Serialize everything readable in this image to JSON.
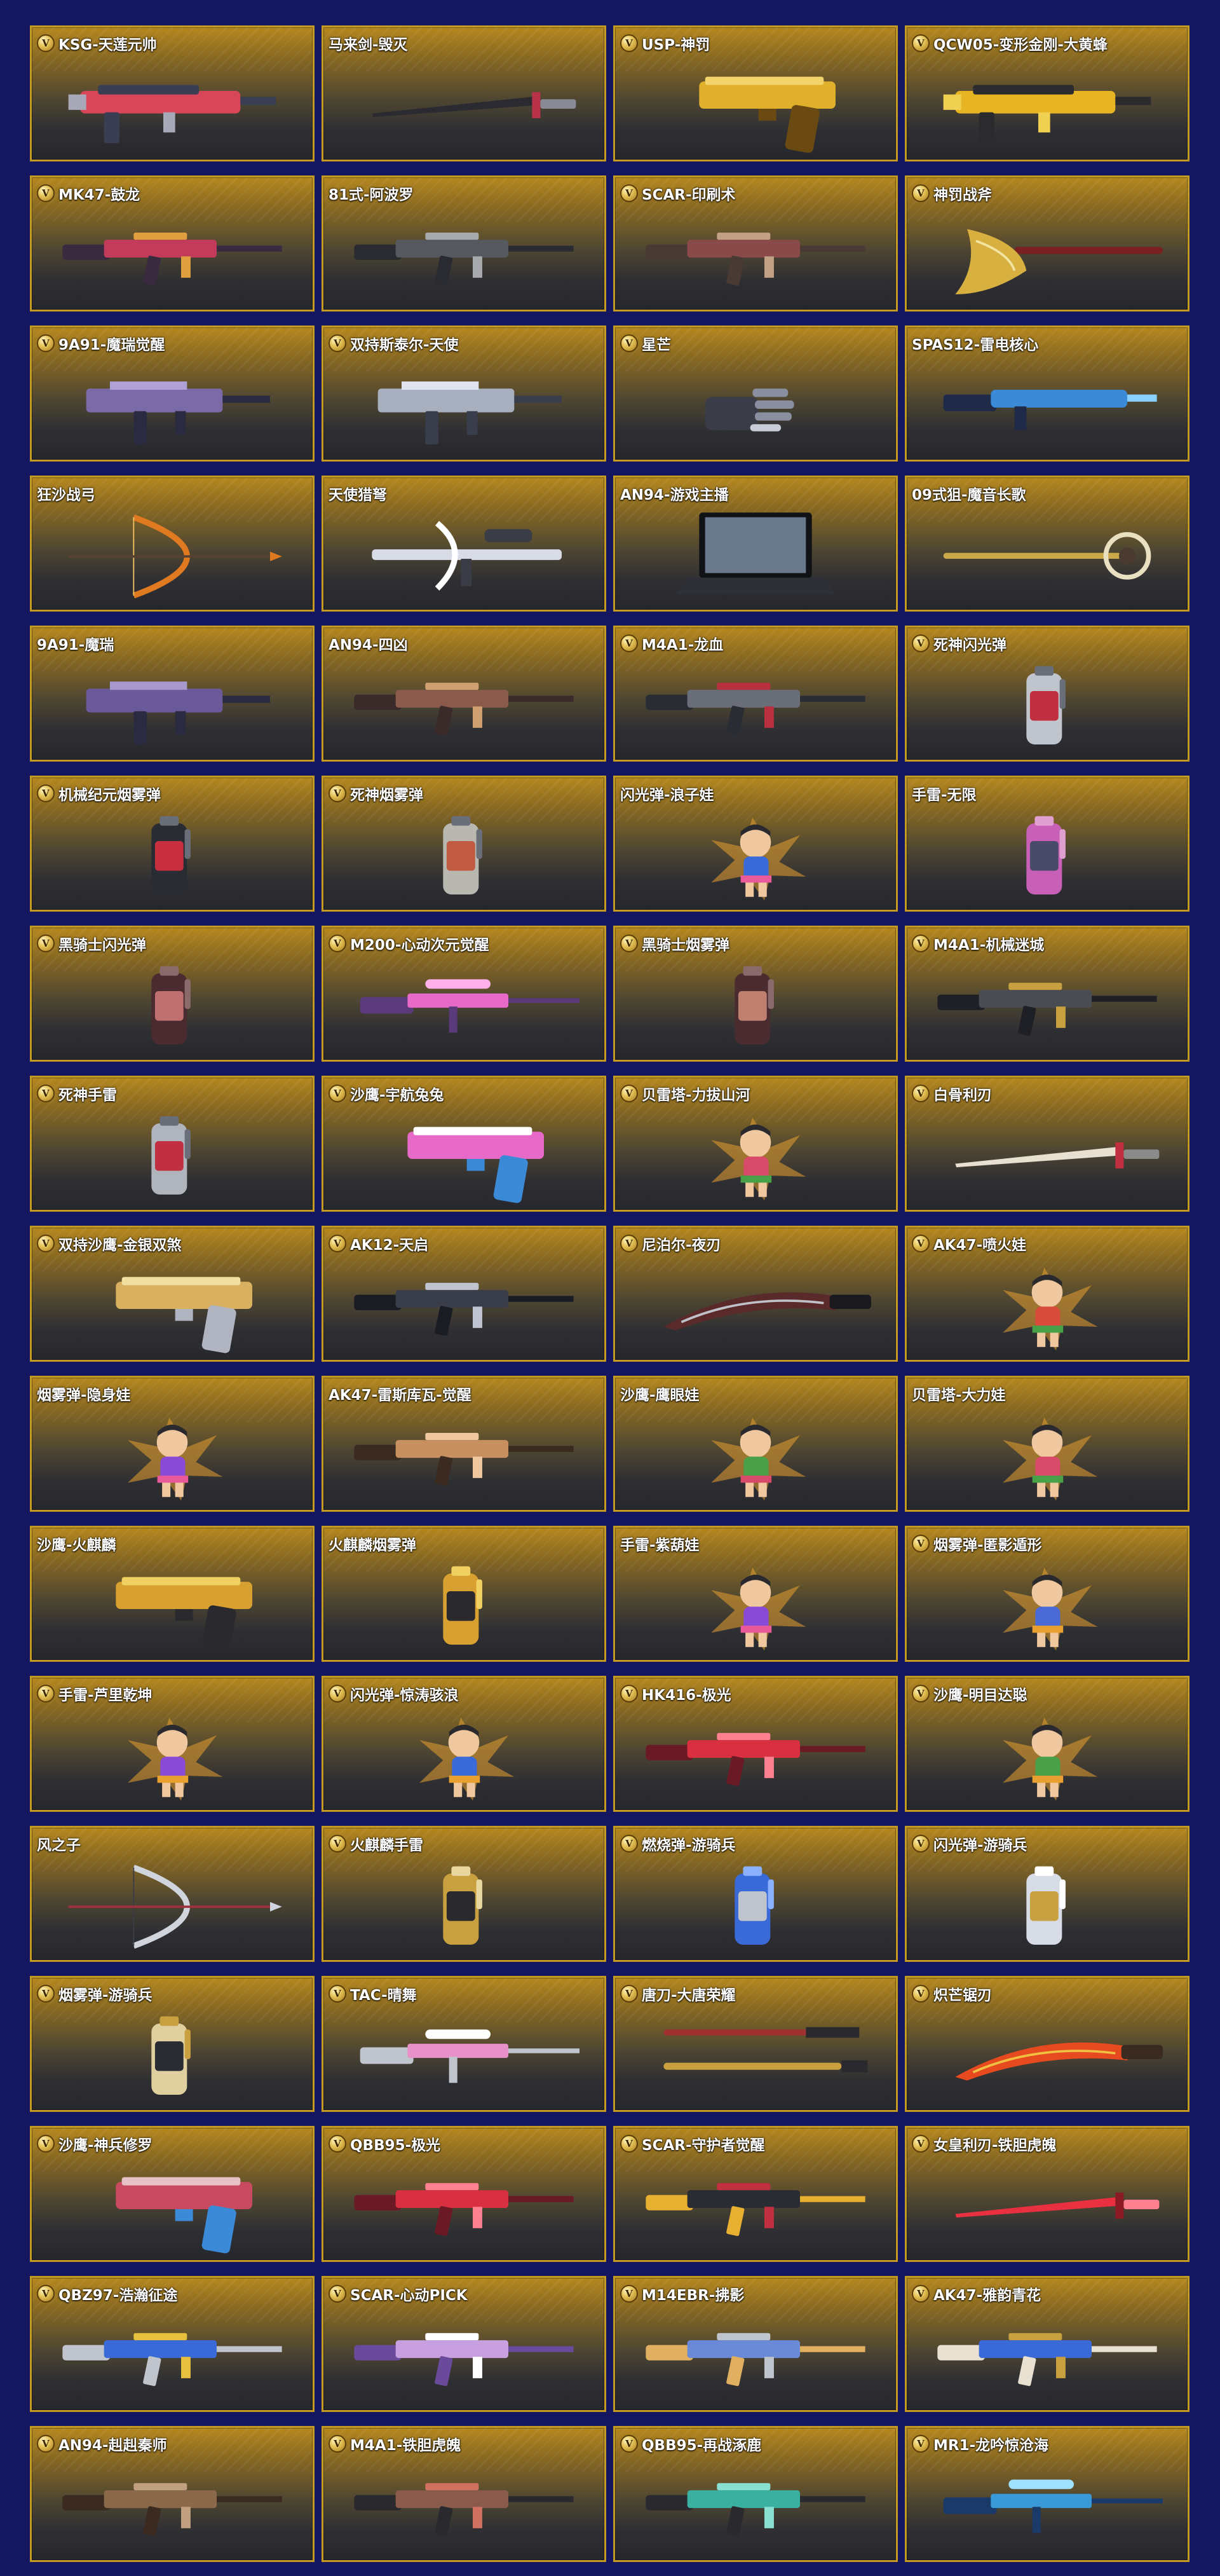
{
  "colors": {
    "background": "#151660",
    "card_border": "#c39a22",
    "card_top": "#b5871f",
    "card_bottom": "#26272c"
  },
  "items": [
    {
      "name": "KSG-天莲元帅",
      "badge": "V",
      "kind": "gun",
      "palette": [
        "#d8465a",
        "#3a3e52",
        "#a7a9b8"
      ]
    },
    {
      "name": "马来剑-毁灭",
      "badge": "",
      "kind": "sword",
      "palette": [
        "#2a2a30",
        "#b8324a",
        "#8a8a96"
      ]
    },
    {
      "name": "USP-神罚",
      "badge": "V",
      "kind": "pistol",
      "palette": [
        "#e0b02c",
        "#6a4a12",
        "#f2d46a"
      ]
    },
    {
      "name": "QCW05-变形金刚-大黄蜂",
      "badge": "V",
      "kind": "gun",
      "palette": [
        "#e7b423",
        "#2b2b2e",
        "#f0d050"
      ]
    },
    {
      "name": "MK47-鼓龙",
      "badge": "V",
      "kind": "rifle",
      "palette": [
        "#c23b5a",
        "#3a2a40",
        "#e0a040"
      ]
    },
    {
      "name": "81式-阿波罗",
      "badge": "",
      "kind": "rifle",
      "palette": [
        "#55585e",
        "#2a2b30",
        "#a8a9ad"
      ]
    },
    {
      "name": "SCAR-印刷术",
      "badge": "V",
      "kind": "rifle",
      "palette": [
        "#8a4a4a",
        "#4a3a34",
        "#c2a085"
      ]
    },
    {
      "name": "神罚战斧",
      "badge": "V",
      "kind": "axe",
      "palette": [
        "#d8b040",
        "#7a2020",
        "#f2e4a0"
      ]
    },
    {
      "name": "9A91-魔瑞觉醒",
      "badge": "V",
      "kind": "smg",
      "palette": [
        "#7a6aa8",
        "#2a2a40",
        "#b0a0d8"
      ]
    },
    {
      "name": "双持斯泰尔-天使",
      "badge": "V",
      "kind": "smg",
      "palette": [
        "#a8b0c0",
        "#3a3e4c",
        "#dfe4ee"
      ]
    },
    {
      "name": "星芒",
      "badge": "V",
      "kind": "glove",
      "palette": [
        "#8a8fa0",
        "#3a3d48",
        "#c8ccd6"
      ]
    },
    {
      "name": "SPAS12-雷电核心",
      "badge": "",
      "kind": "shotgun",
      "palette": [
        "#3a8ad8",
        "#1e2a48",
        "#8ad0ff"
      ]
    },
    {
      "name": "狂沙战弓",
      "badge": "",
      "kind": "bow",
      "palette": [
        "#e07a20",
        "#5a4030",
        "#f2c060"
      ]
    },
    {
      "name": "天使猎弩",
      "badge": "",
      "kind": "crossbow",
      "palette": [
        "#d8dce6",
        "#3a3c46",
        "#ffffff"
      ]
    },
    {
      "name": "AN94-游戏主播",
      "badge": "",
      "kind": "laptop",
      "palette": [
        "#2e3038",
        "#111216",
        "#6a7a8c"
      ]
    },
    {
      "name": "09式狙-魔音长歌",
      "badge": "",
      "kind": "staff",
      "palette": [
        "#c9a94a",
        "#4a3a30",
        "#e8e0c0"
      ]
    },
    {
      "name": "9A91-魔瑞",
      "badge": "",
      "kind": "smg",
      "palette": [
        "#6a5a9a",
        "#2a2a40",
        "#a898d0"
      ]
    },
    {
      "name": "AN94-四凶",
      "badge": "",
      "kind": "rifle",
      "palette": [
        "#8a5a4a",
        "#3a2a2a",
        "#d0a070"
      ]
    },
    {
      "name": "M4A1-龙血",
      "badge": "V",
      "kind": "rifle",
      "palette": [
        "#6a6e78",
        "#2a2c34",
        "#b83040"
      ]
    },
    {
      "name": "死神闪光弹",
      "badge": "V",
      "kind": "canister",
      "palette": [
        "#c0c4cc",
        "#c03040",
        "#6a6e78"
      ]
    },
    {
      "name": "机械纪元烟雾弹",
      "badge": "V",
      "kind": "canister",
      "palette": [
        "#2a2c34",
        "#c83040",
        "#6a6e78"
      ]
    },
    {
      "name": "死神烟雾弹",
      "badge": "V",
      "kind": "canister",
      "palette": [
        "#b8b8b0",
        "#c05a40",
        "#6a6e78"
      ]
    },
    {
      "name": "闪光弹-浪子娃",
      "badge": "",
      "kind": "doll",
      "palette": [
        "#3a6ad8",
        "#e85a9a",
        "#f0c8a0"
      ]
    },
    {
      "name": "手雷-无限",
      "badge": "",
      "kind": "canister",
      "palette": [
        "#c860b8",
        "#4a4a6a",
        "#e0a0d0"
      ]
    },
    {
      "name": "黑骑士闪光弹",
      "badge": "V",
      "kind": "canister",
      "palette": [
        "#4a2c30",
        "#c07070",
        "#8a6a6a"
      ]
    },
    {
      "name": "M200-心动次元觉醒",
      "badge": "V",
      "kind": "sniper",
      "palette": [
        "#e86ac8",
        "#5a3a7a",
        "#ffb0e8"
      ]
    },
    {
      "name": "黑骑士烟雾弹",
      "badge": "V",
      "kind": "canister",
      "palette": [
        "#4a2c30",
        "#c08070",
        "#8a6a6a"
      ]
    },
    {
      "name": "M4A1-机械迷城",
      "badge": "V",
      "kind": "rifle",
      "palette": [
        "#4a4c54",
        "#1e2026",
        "#c8a040"
      ]
    },
    {
      "name": "死神手雷",
      "badge": "V",
      "kind": "canister",
      "palette": [
        "#b0b4bc",
        "#c03040",
        "#6a6e78"
      ]
    },
    {
      "name": "沙鹰-宇航兔兔",
      "badge": "V",
      "kind": "pistol",
      "palette": [
        "#e86ac8",
        "#3a8ad8",
        "#ffffff"
      ]
    },
    {
      "name": "贝雷塔-力拔山河",
      "badge": "V",
      "kind": "doll",
      "palette": [
        "#d84a6a",
        "#48a048",
        "#f0c8a0"
      ]
    },
    {
      "name": "白骨利刃",
      "badge": "V",
      "kind": "sword",
      "palette": [
        "#e8e0d0",
        "#c03040",
        "#8a8a8a"
      ]
    },
    {
      "name": "双持沙鹰-金银双煞",
      "badge": "V",
      "kind": "pistol",
      "palette": [
        "#d8b060",
        "#b0b4c0",
        "#f0e0a0"
      ]
    },
    {
      "name": "AK12-天启",
      "badge": "V",
      "kind": "rifle",
      "palette": [
        "#3a3e4a",
        "#1a1c24",
        "#c0c4d0"
      ]
    },
    {
      "name": "尼泊尔-夜刃",
      "badge": "V",
      "kind": "blade",
      "palette": [
        "#5a2a2a",
        "#1a1a1e",
        "#c0c0c8"
      ]
    },
    {
      "name": "AK47-喷火娃",
      "badge": "V",
      "kind": "doll",
      "palette": [
        "#d84a3a",
        "#48a048",
        "#f0c8a0"
      ]
    },
    {
      "name": "烟雾弹-隐身娃",
      "badge": "",
      "kind": "doll",
      "palette": [
        "#8a4ad8",
        "#e85a9a",
        "#f0c8a0"
      ]
    },
    {
      "name": "AK47-雷斯库瓦-觉醒",
      "badge": "",
      "kind": "rifle",
      "palette": [
        "#c89060",
        "#3a2a20",
        "#f0c8a0"
      ]
    },
    {
      "name": "沙鹰-鹰眼娃",
      "badge": "",
      "kind": "doll",
      "palette": [
        "#4aa048",
        "#d84a6a",
        "#f0c8a0"
      ]
    },
    {
      "name": "贝雷塔-大力娃",
      "badge": "",
      "kind": "doll",
      "palette": [
        "#d84a6a",
        "#48a048",
        "#f0c8a0"
      ]
    },
    {
      "name": "沙鹰-火麒麟",
      "badge": "",
      "kind": "pistol",
      "palette": [
        "#d8a030",
        "#2a2a2e",
        "#f0d060"
      ]
    },
    {
      "name": "火麒麟烟雾弹",
      "badge": "",
      "kind": "canister",
      "palette": [
        "#d8a030",
        "#2a2a2e",
        "#f0d060"
      ]
    },
    {
      "name": "手雷-紫葫娃",
      "badge": "",
      "kind": "doll",
      "palette": [
        "#8a4ad8",
        "#e85a9a",
        "#f0c8a0"
      ]
    },
    {
      "name": "烟雾弹-匿影遁形",
      "badge": "V",
      "kind": "doll",
      "palette": [
        "#4a6ad8",
        "#e8a030",
        "#f0c8a0"
      ]
    },
    {
      "name": "手雷-芦里乾坤",
      "badge": "V",
      "kind": "doll",
      "palette": [
        "#8a4ad8",
        "#e8a030",
        "#f0c8a0"
      ]
    },
    {
      "name": "闪光弹-惊涛骇浪",
      "badge": "V",
      "kind": "doll",
      "palette": [
        "#3a6ad8",
        "#e8a030",
        "#f0c8a0"
      ]
    },
    {
      "name": "HK416-极光",
      "badge": "V",
      "kind": "rifle",
      "palette": [
        "#d83040",
        "#6a1a24",
        "#ff8090"
      ]
    },
    {
      "name": "沙鹰-明目达聪",
      "badge": "V",
      "kind": "doll",
      "palette": [
        "#4aa048",
        "#e8a030",
        "#f0c8a0"
      ]
    },
    {
      "name": "风之子",
      "badge": "",
      "kind": "bow",
      "palette": [
        "#d0d4dc",
        "#a03040",
        "#3a3c46"
      ]
    },
    {
      "name": "火麒麟手雷",
      "badge": "V",
      "kind": "canister",
      "palette": [
        "#c8a040",
        "#2a2a2e",
        "#e8d8a0"
      ]
    },
    {
      "name": "燃烧弹-游骑兵",
      "badge": "V",
      "kind": "canister",
      "palette": [
        "#3a6ad8",
        "#c0c4cc",
        "#8ab0ff"
      ]
    },
    {
      "name": "闪光弹-游骑兵",
      "badge": "V",
      "kind": "canister",
      "palette": [
        "#d8dce6",
        "#c8a040",
        "#ffffff"
      ]
    },
    {
      "name": "烟雾弹-游骑兵",
      "badge": "V",
      "kind": "canister",
      "palette": [
        "#e0d0a0",
        "#2a2c34",
        "#c8a040"
      ]
    },
    {
      "name": "TAC-晴舞",
      "badge": "V",
      "kind": "sniper",
      "palette": [
        "#e890c8",
        "#c0c4cc",
        "#ffffff"
      ]
    },
    {
      "name": "唐刀-大唐荣耀",
      "badge": "V",
      "kind": "katana",
      "palette": [
        "#c8a040",
        "#2a2a2e",
        "#a03030"
      ]
    },
    {
      "name": "炽芒锯刃",
      "badge": "V",
      "kind": "blade",
      "palette": [
        "#e84a20",
        "#3a2a20",
        "#f0c040"
      ]
    },
    {
      "name": "沙鹰-神兵修罗",
      "badge": "V",
      "kind": "pistol",
      "palette": [
        "#c84a60",
        "#3a8ad8",
        "#e8c0c8"
      ]
    },
    {
      "name": "QBB95-极光",
      "badge": "V",
      "kind": "rifle",
      "palette": [
        "#d83040",
        "#6a1a24",
        "#ff8090"
      ]
    },
    {
      "name": "SCAR-守护者觉醒",
      "badge": "V",
      "kind": "rifle",
      "palette": [
        "#2a2c34",
        "#e8b030",
        "#c03040"
      ]
    },
    {
      "name": "女皇利刃-铁胆虎魄",
      "badge": "V",
      "kind": "sword",
      "palette": [
        "#e83040",
        "#8a1a24",
        "#ff8090"
      ]
    },
    {
      "name": "QBZ97-浩瀚征途",
      "badge": "V",
      "kind": "rifle",
      "palette": [
        "#3a6ad8",
        "#c0c4cc",
        "#e8c040"
      ]
    },
    {
      "name": "SCAR-心动PICK",
      "badge": "V",
      "kind": "rifle",
      "palette": [
        "#c8a0e0",
        "#6a4a9a",
        "#ffffff"
      ]
    },
    {
      "name": "M14EBR-拂影",
      "badge": "V",
      "kind": "rifle",
      "palette": [
        "#6a8ad8",
        "#e0b060",
        "#c0c4cc"
      ]
    },
    {
      "name": "AK47-雅韵青花",
      "badge": "V",
      "kind": "rifle",
      "palette": [
        "#3a6ad8",
        "#e8e0d0",
        "#c8a040"
      ]
    },
    {
      "name": "AN94-赳赳秦师",
      "badge": "V",
      "kind": "rifle",
      "palette": [
        "#8a6a4a",
        "#3a2a20",
        "#c0a080"
      ]
    },
    {
      "name": "M4A1-铁胆虎魄",
      "badge": "V",
      "kind": "rifle",
      "palette": [
        "#8a5a4a",
        "#2a2a2e",
        "#d07060"
      ]
    },
    {
      "name": "QBB95-再战涿鹿",
      "badge": "V",
      "kind": "rifle",
      "palette": [
        "#3ab0a0",
        "#2a2a2e",
        "#8ae0d0"
      ]
    },
    {
      "name": "MR1-龙吟惊沧海",
      "badge": "V",
      "kind": "sniper",
      "palette": [
        "#3a9ad8",
        "#1a3a6a",
        "#a0e0ff"
      ]
    }
  ]
}
